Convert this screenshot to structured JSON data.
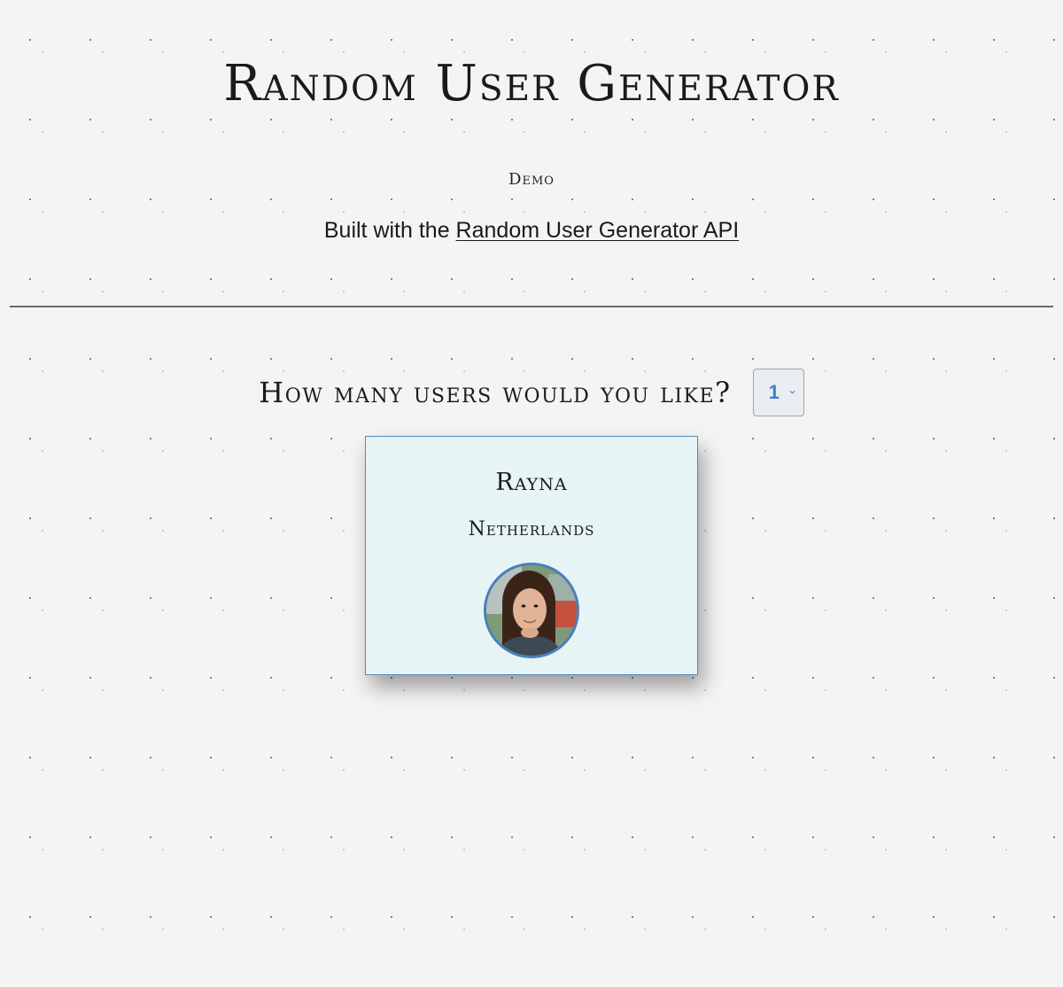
{
  "header": {
    "title": "Random User Generator",
    "subtitle": "Demo",
    "built_with_prefix": "Built with the ",
    "api_link_label": "Random User Generator API"
  },
  "controls": {
    "question": "How many users would you like?",
    "selected_count": "1",
    "accent_color": "#3f7ec8"
  },
  "users": [
    {
      "name": "Rayna",
      "country": "Netherlands",
      "avatar_icon": "user-portrait"
    }
  ]
}
